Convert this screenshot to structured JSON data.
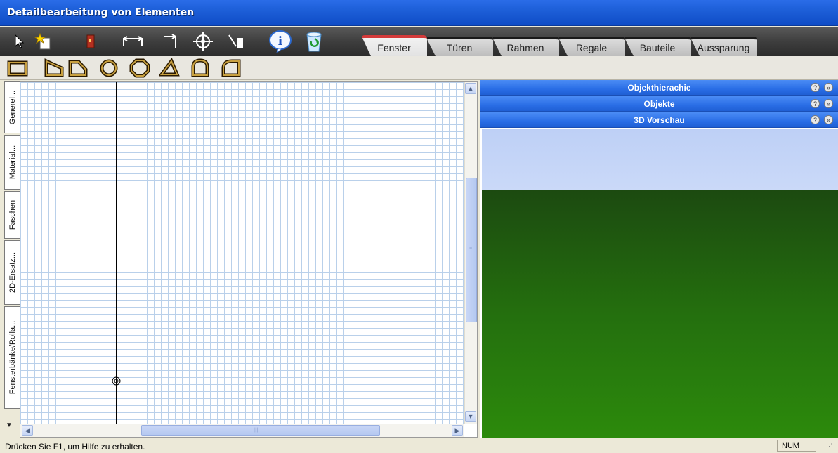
{
  "window": {
    "title": "Detailbearbeitung von Elementen"
  },
  "toolbar": {
    "tools": [
      "select-arrow-icon",
      "new-element-icon",
      "door-icon",
      "dimension-icon",
      "angle-arrow-icon",
      "crosshair-icon",
      "profile-tool-icon",
      "info-icon",
      "recycle-icon"
    ],
    "tabs": [
      {
        "label": "Fenster",
        "active": true
      },
      {
        "label": "Türen",
        "active": false
      },
      {
        "label": "Rahmen",
        "active": false
      },
      {
        "label": "Regale",
        "active": false
      },
      {
        "label": "Bauteile",
        "active": false
      },
      {
        "label": "Aussparung",
        "active": false
      }
    ],
    "cancel_icon": "cancel-icon",
    "ok_icon": "checkmark-icon"
  },
  "shapes": [
    "rectangle",
    "trapezoid-right",
    "trapezoid-top",
    "circle",
    "octagon",
    "triangle",
    "arch",
    "quarter-round"
  ],
  "side_tabs": [
    "Generel...",
    "Material...",
    "Faschen",
    "2D-Ersatz...",
    "Fensterbänke/Rolla..."
  ],
  "right_panel": {
    "sections": [
      {
        "label": "Objekthierachie"
      },
      {
        "label": "Objekte"
      },
      {
        "label": "3D Vorschau"
      }
    ],
    "help_symbol": "?",
    "collapse_symbol": "»"
  },
  "scroll": {
    "up": "▲",
    "down": "▼",
    "left": "◀",
    "right": "▶"
  },
  "status": {
    "message": "Drücken Sie F1, um Hilfe zu erhalten.",
    "num": "NUM"
  },
  "colors": {
    "title_blue": "#1d5fd8",
    "grid_line": "#b9d0ea",
    "panel_header": "#2a6ee6",
    "sky": "#c4d5f7",
    "ground": "#246f0e"
  }
}
